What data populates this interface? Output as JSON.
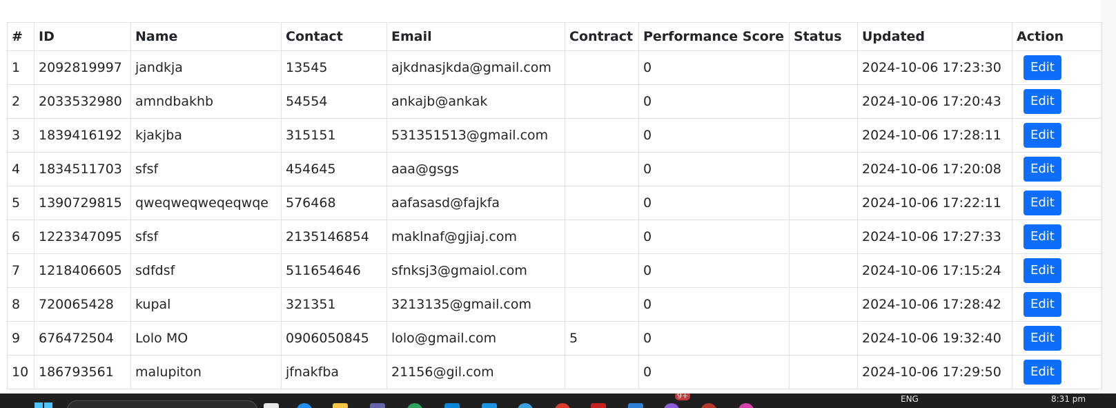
{
  "table": {
    "headers": [
      "#",
      "ID",
      "Name",
      "Contact",
      "Email",
      "Contract",
      "Performance Score",
      "Status",
      "Updated",
      "Action"
    ],
    "rows": [
      {
        "n": "1",
        "id": "2092819997",
        "name": "jandkja",
        "contact": "13545",
        "email": "ajkdnasjkda@gmail.com",
        "contract": "",
        "score": "0",
        "status": "",
        "updated": "2024-10-06 17:23:30",
        "action": "Edit"
      },
      {
        "n": "2",
        "id": "2033532980",
        "name": "amndbakhb",
        "contact": "54554",
        "email": "ankajb@ankak",
        "contract": "",
        "score": "0",
        "status": "",
        "updated": "2024-10-06 17:20:43",
        "action": "Edit"
      },
      {
        "n": "3",
        "id": "1839416192",
        "name": "kjakjba",
        "contact": "315151",
        "email": "531351513@gmail.com",
        "contract": "",
        "score": "0",
        "status": "",
        "updated": "2024-10-06 17:28:11",
        "action": "Edit"
      },
      {
        "n": "4",
        "id": "1834511703",
        "name": "sfsf",
        "contact": "454645",
        "email": "aaa@gsgs",
        "contract": "",
        "score": "0",
        "status": "",
        "updated": "2024-10-06 17:20:08",
        "action": "Edit"
      },
      {
        "n": "5",
        "id": "1390729815",
        "name": "qweqweqweqeqwqe",
        "contact": "576468",
        "email": "aafasasd@fajkfa",
        "contract": "",
        "score": "0",
        "status": "",
        "updated": "2024-10-06 17:22:11",
        "action": "Edit"
      },
      {
        "n": "6",
        "id": "1223347095",
        "name": "sfsf",
        "contact": "2135146854",
        "email": "maklnaf@gjiaj.com",
        "contract": "",
        "score": "0",
        "status": "",
        "updated": "2024-10-06 17:27:33",
        "action": "Edit"
      },
      {
        "n": "7",
        "id": "1218406605",
        "name": "sdfdsf",
        "contact": "511654646",
        "email": "sfnksj3@gmaiol.com",
        "contract": "",
        "score": "0",
        "status": "",
        "updated": "2024-10-06 17:15:24",
        "action": "Edit"
      },
      {
        "n": "8",
        "id": "720065428",
        "name": "kupal",
        "contact": "321351",
        "email": "3213135@gmail.com",
        "contract": "",
        "score": "0",
        "status": "",
        "updated": "2024-10-06 17:28:42",
        "action": "Edit"
      },
      {
        "n": "9",
        "id": "676472504",
        "name": "Lolo MO",
        "contact": "0906050845",
        "email": "lolo@gmail.com",
        "contract": "5",
        "score": "0",
        "status": "",
        "updated": "2024-10-06 19:32:40",
        "action": "Edit"
      },
      {
        "n": "10",
        "id": "186793561",
        "name": "malupiton",
        "contact": "jfnakfba",
        "email": "21156@gil.com",
        "contract": "",
        "score": "0",
        "status": "",
        "updated": "2024-10-06 17:29:50",
        "action": "Edit"
      }
    ]
  },
  "taskbar": {
    "language": "ENG",
    "time": "8:31 pm",
    "badge": "9+"
  },
  "colors": {
    "edit_button": "#0d6efd",
    "taskbar": "#1f1f1f",
    "border": "#dee2e6"
  }
}
